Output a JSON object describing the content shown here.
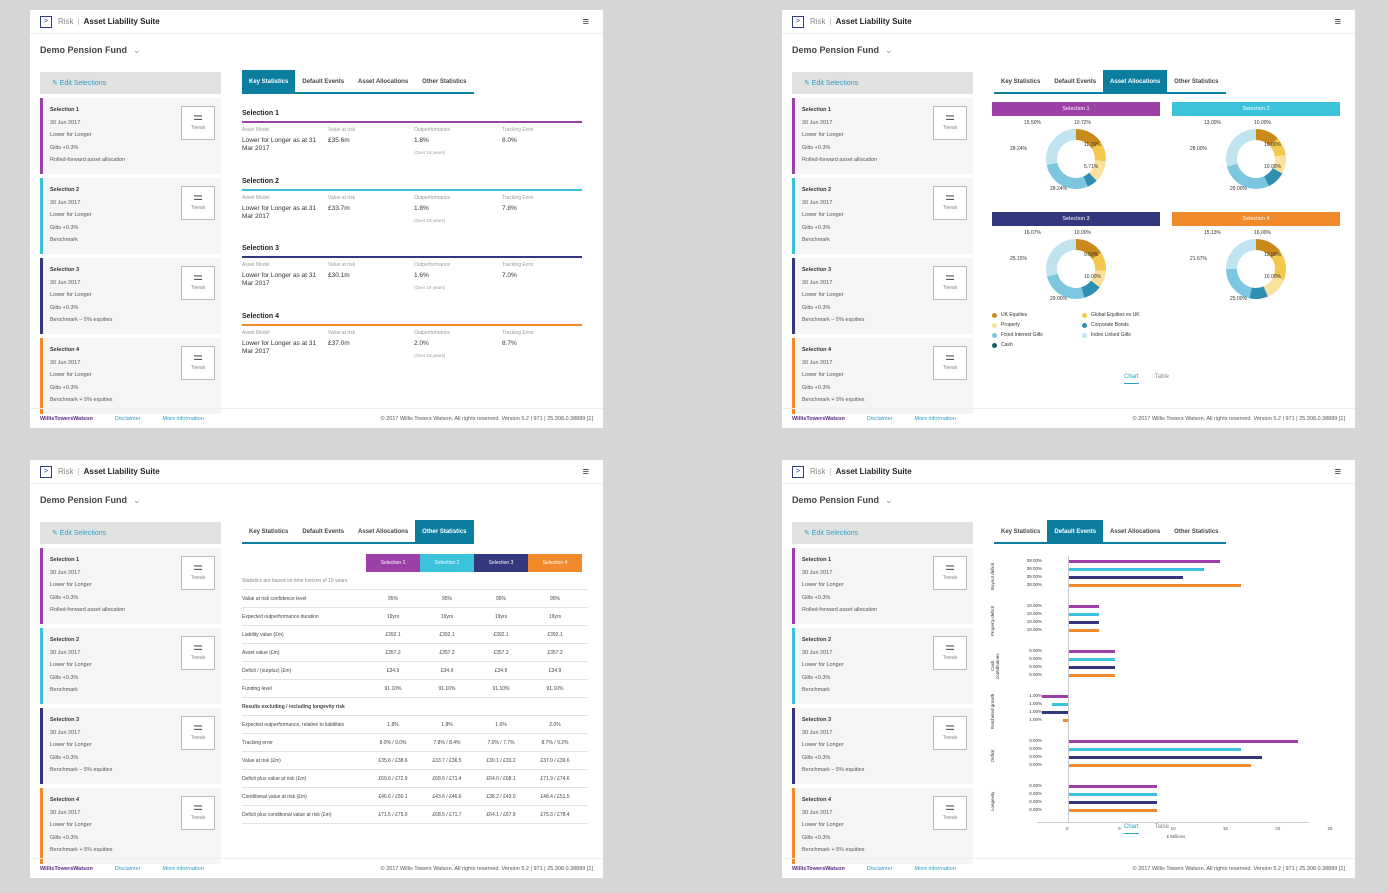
{
  "app": {
    "brand_icon": ">",
    "brand_risk": "Risk",
    "brand_suite": "Asset Liability Suite",
    "fund": "Demo Pension Fund",
    "fund_chevron": "⌄",
    "menu_icon": "hamburger-icon",
    "menu_glyph": "≡"
  },
  "sidebar": {
    "edit": "✎  Edit Selections",
    "tweak_glyph": "⚌",
    "tweak_label": "Tweak",
    "selections": [
      {
        "title": "Selection 1",
        "date": "30 Jun 2017",
        "strategy": "Lower for Longer",
        "gilts": "Gilts +0.3%",
        "extra": "Rolled-forward asset allocation"
      },
      {
        "title": "Selection 2",
        "date": "30 Jun 2017",
        "strategy": "Lower for Longer",
        "gilts": "Gilts +0.3%",
        "extra": "Benchmark"
      },
      {
        "title": "Selection 3",
        "date": "30 Jun 2017",
        "strategy": "Lower for Longer",
        "gilts": "Gilts +0.3%",
        "extra": "Benchmark – 5% equities"
      },
      {
        "title": "Selection 4",
        "date": "30 Jun 2017",
        "strategy": "Lower for Longer",
        "gilts": "Gilts +0.3%",
        "extra": "Benchmark + 5% equities"
      }
    ]
  },
  "tabs": [
    "Key Statistics",
    "Default Events",
    "Asset Allocations",
    "Other Statistics"
  ],
  "footer": {
    "brand": "WillisTowersWatson",
    "disclaimer": "Disclaimer",
    "more": "More information",
    "copyright": "© 2017 Willis Towers Watson. All rights reserved. Version 5.2 | 971 | 25.308.0.38889 [1]"
  },
  "colors": {
    "s1": "#9c3fa6",
    "s2": "#3cc3dc",
    "s3": "#33387e",
    "s4": "#f18a2a",
    "tab": "#0b7ea0"
  },
  "key_stats": {
    "headers": [
      "Asset Model",
      "Value at risk",
      "Outperformance",
      "Tracking Error"
    ],
    "items": [
      {
        "title": "Selection 1",
        "model": "Lower for Longer as at 31 Mar 2017",
        "var": "£35.6m",
        "outperf": "1.8%",
        "sub": "(Over 19 years)",
        "te": "8.0%"
      },
      {
        "title": "Selection 2",
        "model": "Lower for Longer as at 31 Mar 2017",
        "var": "£33.7m",
        "outperf": "1.8%",
        "sub": "(Over 19 years)",
        "te": "7.8%"
      },
      {
        "title": "Selection 3",
        "model": "Lower for Longer as at 31 Mar 2017",
        "var": "£30.1m",
        "outperf": "1.6%",
        "sub": "(Over 19 years)",
        "te": "7.0%"
      },
      {
        "title": "Selection 4",
        "model": "Lower for Longer as at 31 Mar 2017",
        "var": "£37.0m",
        "outperf": "2.0%",
        "sub": "(Over 19 years)",
        "te": "8.7%"
      }
    ]
  },
  "alloc": {
    "donuts": [
      {
        "title": "Selection 1",
        "slices": [
          15.5,
          10.7,
          11.7,
          5.7,
          28.2,
          28.2
        ],
        "labels": [
          "15.50%",
          "10.72%",
          "11.76%",
          "5.71%",
          "28.24%",
          "28.24%"
        ]
      },
      {
        "title": "Selection 2",
        "slices": [
          13.0,
          10.0,
          10.0,
          10.0,
          28.0,
          29.0
        ],
        "labels": [
          "13.00%",
          "10.00%",
          "10.00%",
          "10.00%",
          "28.00%",
          "29.00%"
        ]
      },
      {
        "title": "Selection 3",
        "slices": [
          16.0,
          10.0,
          9.5,
          10.0,
          25.5,
          29.0
        ],
        "labels": [
          "16.07%",
          "10.00%",
          "9.50%",
          "10.00%",
          "25.15%",
          "29.00%"
        ]
      },
      {
        "title": "Selection 4",
        "slices": [
          15.0,
          16.0,
          12.5,
          10.0,
          21.5,
          25.0
        ],
        "labels": [
          "15.13%",
          "16.00%",
          "12.50%",
          "10.00%",
          "21.67%",
          "25.00%"
        ]
      }
    ],
    "legend": [
      {
        "label": "UK Equities",
        "color": "#c98a1b"
      },
      {
        "label": "Global Equities ex UK",
        "color": "#f2c94c"
      },
      {
        "label": "Property",
        "color": "#fae19e"
      },
      {
        "label": "Corporate Bonds",
        "color": "#2f8fb0"
      },
      {
        "label": "Fixed Interest Gilts",
        "color": "#7cc7df"
      },
      {
        "label": "Index Linked Gilts",
        "color": "#bfe4ef"
      },
      {
        "label": "Cash",
        "color": "#145f6f"
      }
    ],
    "chart": "Chart",
    "table": "Table"
  },
  "other": {
    "headers": [
      "Selection 1",
      "Selection 2",
      "Selection 3",
      "Selection 4"
    ],
    "top": "Statistics are based on time horizon of 19 years",
    "rows": [
      [
        "Value at risk confidence level",
        "95%",
        "95%",
        "95%",
        "95%"
      ],
      [
        "Expected outperformance duration",
        "19yrs",
        "19yrs",
        "19yrs",
        "19yrs"
      ],
      [
        "Liability value (£m)",
        "£392.1",
        "£392.1",
        "£392.1",
        "£392.1"
      ],
      [
        "Asset value (£m)",
        "£357.2",
        "£357.2",
        "£357.2",
        "£357.2"
      ],
      [
        "Deficit / (surplus) (£m)",
        "£34.9",
        "£34.9",
        "£34.9",
        "£34.9"
      ],
      [
        "Funding level",
        "91.10%",
        "91.10%",
        "91.10%",
        "91.10%"
      ],
      [
        "Results excluding / including longevity risk",
        "",
        "",
        "",
        ""
      ],
      [
        "Expected outperformance, relative to liabilities",
        "1.8%",
        "1.8%",
        "1.6%",
        "2.0%"
      ],
      [
        "Tracking error",
        "8.0% / 9.0%",
        "7.8% / 8.4%",
        "7.0% / 7.7%",
        "8.7% / 9.2%"
      ],
      [
        "Value at risk (£m)",
        "£35.6 / £38.6",
        "£33.7 / £36.5",
        "£30.1 / £33.2",
        "£37.0 / £39.6"
      ],
      [
        "Deficit plus value at risk (£m)",
        "£69.6 / £72.9",
        "£68.6 / £71.4",
        "£64.0 / £68.1",
        "£71.9 / £74.6"
      ],
      [
        "Conditional value at risk (£m)",
        "£46.6 / £50.1",
        "£43.6 / £46.6",
        "£38.2 / £43.0",
        "£48.4 / £51.5"
      ],
      [
        "Deficit plus conditional value at risk (£m)",
        "£71.5 / £75.0",
        "£68.5 / £71.7",
        "£64.1 / £67.9",
        "£75.3 / £78.4"
      ]
    ]
  },
  "chart_data": {
    "type": "bar",
    "groups": [
      {
        "name": "Buyout deficit",
        "labels": [
          "28.00%",
          "26.00%",
          "25.00%",
          "28.00%"
        ],
        "values": [
          14.5,
          13.0,
          11.0,
          16.5
        ]
      },
      {
        "name": "Property deficit",
        "labels": [
          "10.00%",
          "10.00%",
          "10.00%",
          "10.00%"
        ],
        "values": [
          3.0,
          3.0,
          3.0,
          3.0
        ]
      },
      {
        "name": "Cash contributions",
        "labels": [
          "5.00%",
          "5.00%",
          "5.00%",
          "5.00%"
        ],
        "values": [
          4.5,
          4.5,
          4.5,
          4.5
        ]
      },
      {
        "name": "Ratcheted growth",
        "labels": [
          "1.00%",
          "1.00%",
          "1.00%",
          "1.00%"
        ],
        "values": [
          -2.5,
          -1.5,
          -2.5,
          -0.5
        ]
      },
      {
        "name": "Deficit",
        "labels": [
          "0.00%",
          "0.00%",
          "0.00%",
          "0.00%"
        ],
        "values": [
          22.0,
          16.5,
          18.5,
          17.5
        ]
      },
      {
        "name": "Longevity",
        "labels": [
          "0.00%",
          "0.00%",
          "0.00%",
          "0.00%"
        ],
        "values": [
          8.5,
          8.5,
          8.5,
          8.5
        ]
      }
    ],
    "xticks": [
      "0",
      "5",
      "10",
      "15",
      "20",
      "25"
    ],
    "xlabel": "£ Millions",
    "xlim": [
      -3,
      23
    ]
  }
}
